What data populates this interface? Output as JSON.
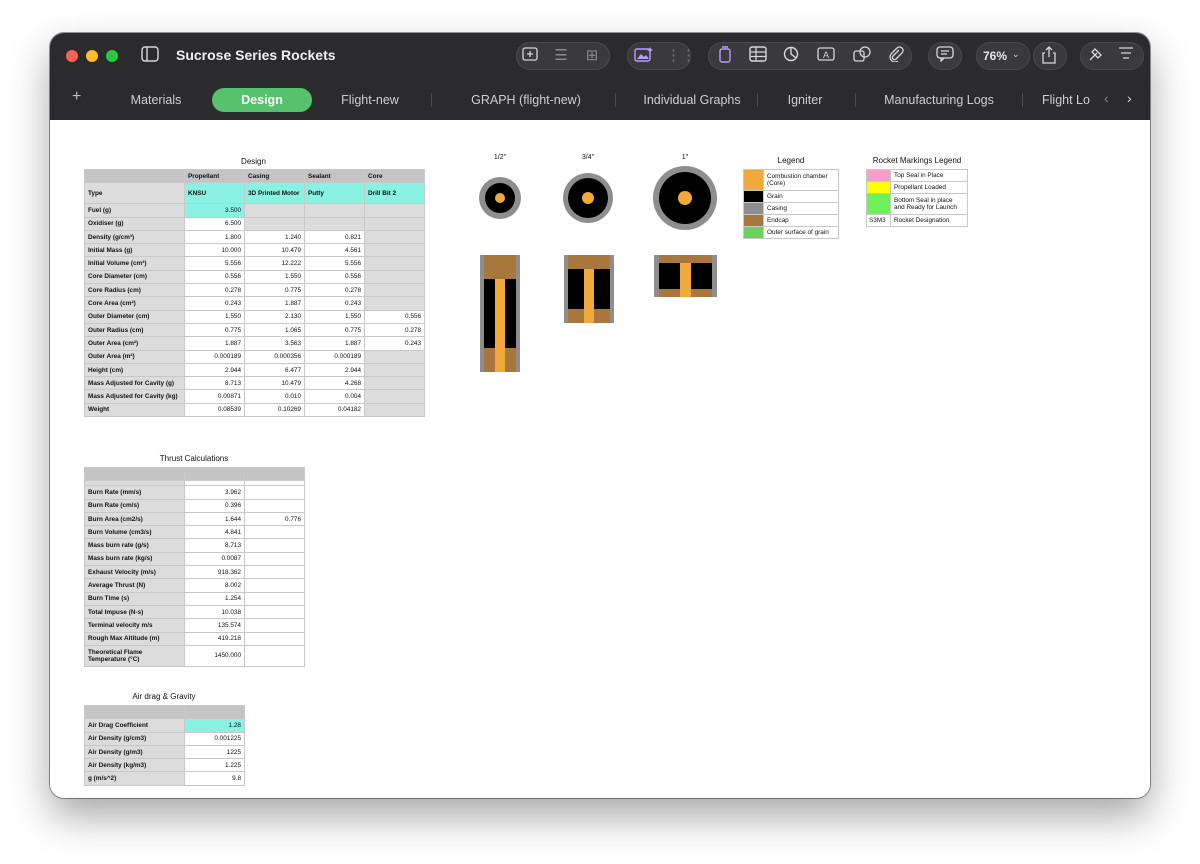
{
  "window": {
    "title": "Sucrose Series Rockets",
    "zoom": "76%"
  },
  "toolbar_icons": [
    "sidebar-icon",
    "insert-icon",
    "list-icon",
    "table-add-icon",
    "media-icon",
    "grid-icon",
    "document-icon",
    "table-icon",
    "chart-icon",
    "text-icon",
    "shape-icon",
    "attachment-icon",
    "comment-icon",
    "share-icon",
    "format-icon",
    "organize-icon"
  ],
  "tabs": [
    "Materials",
    "Design",
    "Flight-new",
    "GRAPH (flight-new)",
    "Individual Graphs",
    "Igniter",
    "Manufacturing Logs",
    "Flight Lo"
  ],
  "active_tab": "Design",
  "design": {
    "caption": "Design",
    "headers": [
      "",
      "Propellant",
      "Casing",
      "Sealant",
      "Core"
    ],
    "type_row": [
      "Type",
      "KNSU",
      "3D Printed Motor",
      "Putty",
      "Drill Bit 2"
    ],
    "rows": [
      [
        "Fuel (g)",
        "3.500",
        "",
        "",
        ""
      ],
      [
        "Oxidiser (g)",
        "6.500",
        "",
        "",
        ""
      ],
      [
        "Density (g/cm³)",
        "1.800",
        "1.240",
        "0.821",
        ""
      ],
      [
        "Initial Mass (g)",
        "10.000",
        "10.479",
        "4.561",
        ""
      ],
      [
        "Initial Volume (cm³)",
        "5.556",
        "12.222",
        "5.556",
        ""
      ],
      [
        "Core Diameter (cm)",
        "0.556",
        "1.550",
        "0.556",
        ""
      ],
      [
        "Core Radius (cm)",
        "0.278",
        "0.775",
        "0.278",
        ""
      ],
      [
        "Core Area (cm²)",
        "0.243",
        "1.887",
        "0.243",
        ""
      ],
      [
        "Outer Diameter (cm)",
        "1.550",
        "2.130",
        "1.550",
        "0.556"
      ],
      [
        "Outer Radius (cm)",
        "0.775",
        "1.065",
        "0.775",
        "0.278"
      ],
      [
        "Outer Area (cm²)",
        "1.887",
        "3.563",
        "1.887",
        "0.243"
      ],
      [
        "Outer Area (m²)",
        "0.000189",
        "0.000356",
        "0.000189",
        ""
      ],
      [
        "Height (cm)",
        "2.944",
        "6.477",
        "2.944",
        ""
      ],
      [
        "Mass Adjusted for Cavity (g)",
        "8.713",
        "10.479",
        "4.268",
        ""
      ],
      [
        "Mass Adjusted for Cavity (kg)",
        "0.00871",
        "0.010",
        "0.004",
        ""
      ],
      [
        "Weight",
        "0.08539",
        "0.10269",
        "0.04182",
        ""
      ]
    ]
  },
  "thrust": {
    "caption": "Thrust Calculations",
    "rows": [
      [
        "Burn Rate (mm/s)",
        "3.962",
        ""
      ],
      [
        "Burn Rate (cm/s)",
        "0.396",
        ""
      ],
      [
        "Burn Area (cm2/s)",
        "1.644",
        "0.776"
      ],
      [
        "Burn Volume (cm3/s)",
        "4.841",
        ""
      ],
      [
        "Mass burn rate (g/s)",
        "8.713",
        ""
      ],
      [
        "Mass burn rate (kg/s)",
        "0.0087",
        ""
      ],
      [
        "Exhaust Velocity (m/s)",
        "918.362",
        ""
      ],
      [
        "Average Thrust (N)",
        "8.002",
        ""
      ],
      [
        "Burn Time (s)",
        "1.254",
        ""
      ],
      [
        "Total Impuse (N-s)",
        "10.038",
        ""
      ],
      [
        "Terminal velocity m/s",
        "135.574",
        ""
      ],
      [
        "Rough Max Altitude (m)",
        "419.218",
        ""
      ],
      [
        "Theoretical Flame Temperature (°C)",
        "1450.000",
        ""
      ]
    ]
  },
  "airdrag": {
    "caption": "Air drag & Gravity",
    "rows": [
      [
        "Air Drag Coefficient",
        "1.28"
      ],
      [
        "Air Density (g/cm3)",
        "0.001225"
      ],
      [
        "Air Density (g/m3)",
        "1225"
      ],
      [
        "Air Density (kg/m3)",
        "1.225"
      ],
      [
        "g (m/s^2)",
        "9.8"
      ]
    ]
  },
  "sizes": [
    "1/2\"",
    "3/4\"",
    "1\""
  ],
  "legend": {
    "caption": "Legend",
    "items": [
      {
        "color": "#f2a93b",
        "label": "Combustion chamber (Core)"
      },
      {
        "color": "#000000",
        "label": "Grain"
      },
      {
        "color": "#8e8e8e",
        "label": "Casing"
      },
      {
        "color": "#a8773e",
        "label": "Endcap"
      },
      {
        "color": "#6fd05b",
        "label": "Outer surface of grain"
      }
    ]
  },
  "markings": {
    "caption": "Rocket Markings Legend",
    "items": [
      {
        "swatch": "",
        "color": "#f3a0cc",
        "label": "Top Seal in Place"
      },
      {
        "swatch": "",
        "color": "#ffff00",
        "label": "Propellant Loaded"
      },
      {
        "swatch": "",
        "color": "#6df25a",
        "label": "Bottom Seal in place and Ready for Launch"
      },
      {
        "swatch": "S3M3",
        "color": "#ffffff",
        "label": "Rocket Designation"
      }
    ]
  }
}
